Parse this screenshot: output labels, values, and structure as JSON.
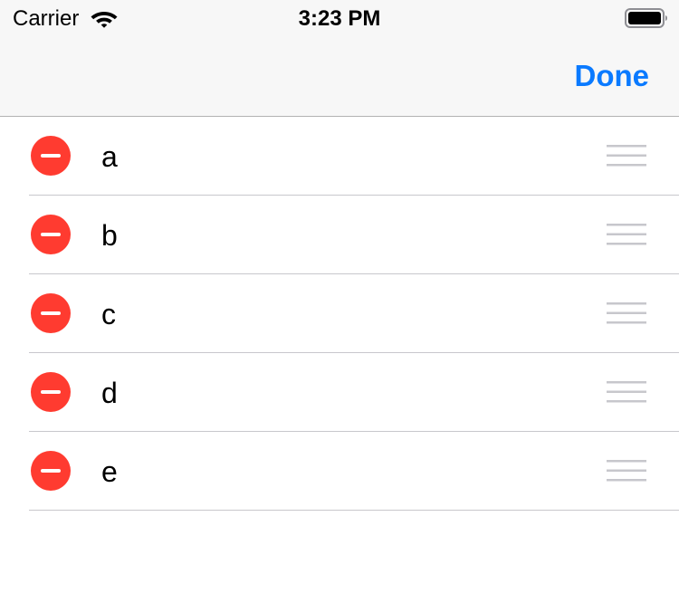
{
  "status_bar": {
    "carrier": "Carrier",
    "time": "3:23 PM",
    "wifi_icon": "wifi-icon",
    "battery_icon": "battery-full-icon"
  },
  "nav_bar": {
    "done_label": "Done"
  },
  "colors": {
    "accent": "#0a7aff",
    "delete_red": "#ff3b30",
    "separator": "#c8c7cc",
    "handle_gray": "#c7c7cc",
    "nav_background": "#f7f7f7"
  },
  "list": {
    "mode": "editing",
    "items": [
      {
        "label": "a",
        "delete_icon": "minus-circle-icon",
        "reorder_icon": "reorder-handle-icon"
      },
      {
        "label": "b",
        "delete_icon": "minus-circle-icon",
        "reorder_icon": "reorder-handle-icon"
      },
      {
        "label": "c",
        "delete_icon": "minus-circle-icon",
        "reorder_icon": "reorder-handle-icon"
      },
      {
        "label": "d",
        "delete_icon": "minus-circle-icon",
        "reorder_icon": "reorder-handle-icon"
      },
      {
        "label": "e",
        "delete_icon": "minus-circle-icon",
        "reorder_icon": "reorder-handle-icon"
      }
    ]
  }
}
